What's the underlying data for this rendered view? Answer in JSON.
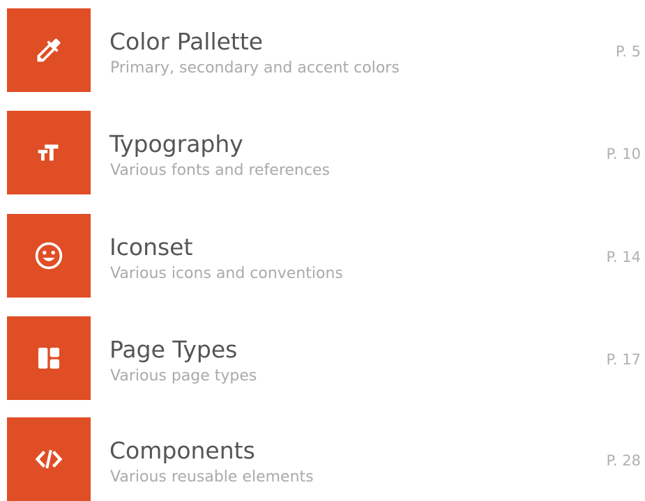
{
  "accent_color": "#e04e25",
  "toc": {
    "items": [
      {
        "icon": "eyedropper-icon",
        "title": "Color Pallette",
        "subtitle": "Primary, secondary and accent colors",
        "page": "P. 5"
      },
      {
        "icon": "text-size-icon",
        "title": "Typography",
        "subtitle": "Various fonts and references",
        "page": "P. 10"
      },
      {
        "icon": "smiley-face-icon",
        "title": "Iconset",
        "subtitle": "Various icons and conventions",
        "page": "P. 14"
      },
      {
        "icon": "layout-panels-icon",
        "title": "Page Types",
        "subtitle": "Various page types",
        "page": "P. 17"
      },
      {
        "icon": "code-brackets-icon",
        "title": "Components",
        "subtitle": "Various reusable elements",
        "page": "P. 28"
      }
    ]
  }
}
